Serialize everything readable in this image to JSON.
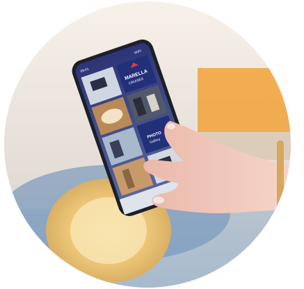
{
  "photo": {
    "subject": "hand-holding-smartphone",
    "colors": {
      "background": "#ece5dd",
      "window": "#f2a23a",
      "melon": "#f0cf84",
      "phone_screen": "#2a2f6e",
      "skin": "#f2cdbf"
    }
  },
  "phone": {
    "status_time": "09:41",
    "header_right": "WIFI",
    "tiles": [
      {
        "label": "MARELLA",
        "sub": "CRUISES"
      },
      {
        "label": "PHOTO",
        "sub": "Gallery"
      }
    ]
  }
}
